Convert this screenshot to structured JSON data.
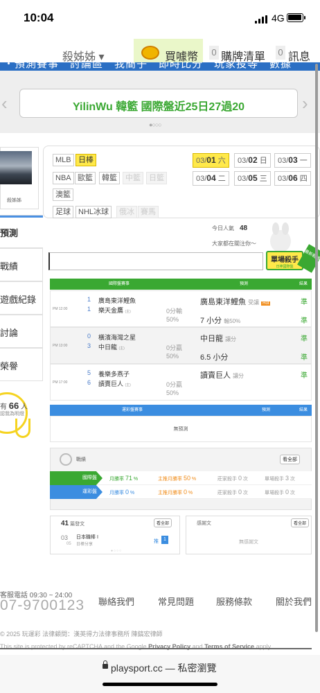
{
  "status_bar": {
    "time": "10:04",
    "network": "4G"
  },
  "nav": {
    "user_label": "殺姊姊 ▾",
    "coin_label": "買噱幣",
    "cart_count": "0",
    "cart_label": "購牌清單",
    "msg_count": "0",
    "msg_label": "訊息",
    "strip_text": "・預測賽事　討論區　我簡子　即時比分　玩家投等　數據"
  },
  "announcement": {
    "text": "YilinWu 韓籃 國際盤近25日27過20",
    "prev": "‹",
    "next": "›",
    "dots": "●○○○"
  },
  "sidebar": {
    "profile_name": "殺姊姊",
    "tabs": [
      "預測",
      "戰績",
      "遊戲紀錄",
      "討論",
      "榮譽"
    ],
    "vote_prefix": "有",
    "vote_count": "66",
    "vote_suffix": "人",
    "vote_sub": "認我為明燈"
  },
  "sports": [
    {
      "label": "MLB",
      "state": "normal"
    },
    {
      "label": "日棒",
      "state": "active"
    },
    {
      "label": "NBA",
      "state": "normal"
    },
    {
      "label": "歐籃",
      "state": "normal"
    },
    {
      "label": "韓籃",
      "state": "normal"
    },
    {
      "label": "中籃",
      "state": "disabled"
    },
    {
      "label": "日籃",
      "state": "disabled"
    },
    {
      "label": "澳籃",
      "state": "normal"
    },
    {
      "label": "足球",
      "state": "normal"
    },
    {
      "label": "NHL冰球",
      "state": "normal"
    },
    {
      "label": "俄冰",
      "state": "disabled"
    },
    {
      "label": "賽馬",
      "state": "disabled"
    }
  ],
  "dates": [
    {
      "md": "03/",
      "day": "01",
      "wd": "六",
      "active": true
    },
    {
      "md": "03/",
      "day": "02",
      "wd": "日",
      "active": false
    },
    {
      "md": "03/",
      "day": "03",
      "wd": "一",
      "active": false
    },
    {
      "md": "03/",
      "day": "04",
      "wd": "二",
      "active": false
    },
    {
      "md": "03/",
      "day": "05",
      "wd": "三",
      "active": false
    },
    {
      "md": "03/",
      "day": "06",
      "wd": "四",
      "active": false
    }
  ],
  "stats": {
    "visitors_label": "今日人氣",
    "visitors_count": "48",
    "watching": "大家都在關注你～",
    "killer_title": "單場殺手",
    "killer_sub": "日棒國際盤",
    "ribbon": "最新戰績"
  },
  "match_table": {
    "headers": [
      "國際盤賽事",
      "預測",
      "結果"
    ],
    "games": [
      {
        "time": "PM 12:00",
        "away_num": "1",
        "away_team": "廣島東洋鯉魚",
        "home_num": "1",
        "home_team": "樂天金鷹",
        "home_tag": "(主)",
        "line1": "0分輸",
        "line2": "50%",
        "pred1_team": "廣島東洋鯉魚",
        "pred1_note": "受讓",
        "pred1_hot": "Hot",
        "pred2_team": "7 小分",
        "pred2_note": "輸50%",
        "result1": "準",
        "result2": "準"
      },
      {
        "time": "PM 13:00",
        "away_num": "0",
        "away_team": "橫濱海灣之星",
        "home_num": "3",
        "home_team": "中日龍",
        "home_tag": "(主)",
        "line1": "0分贏",
        "line2": "50%",
        "pred1_team": "中日龍",
        "pred1_note": "讓分",
        "pred1_hot": "",
        "pred2_team": "6.5 小分",
        "pred2_note": "",
        "result1": "準",
        "result2": "準"
      },
      {
        "time": "PM 17:00",
        "away_num": "5",
        "away_team": "養樂多燕子",
        "home_num": "6",
        "home_team": "讀賣巨人",
        "home_tag": "(主)",
        "line1": "0分贏",
        "line2": "50%",
        "pred1_team": "讀賣巨人",
        "pred1_note": "讓分",
        "pred1_hot": "",
        "pred2_team": "",
        "pred2_note": "",
        "result1": "準",
        "result2": ""
      }
    ]
  },
  "lottery_table": {
    "headers": [
      "運彩盤賽事",
      "預測",
      "結果"
    ],
    "empty": "無預測"
  },
  "record": {
    "title": "戰績",
    "all_button": "看全部",
    "rows": [
      {
        "label": "國際盤",
        "color": "#3aa832",
        "rate_label": "月勝率",
        "rate": "71",
        "main_label": "主推月勝率",
        "main_rate": "50",
        "streak_label": "莊家殺手",
        "streak": "0",
        "single_label": "單場殺手",
        "single": "3",
        "unit": "次"
      },
      {
        "label": "運彩盤",
        "color": "#3b8de0",
        "rate_label": "月勝率",
        "rate": "0",
        "main_label": "主推月勝率",
        "main_rate": "0",
        "streak_label": "莊家殺手",
        "streak": "0",
        "single_label": "單場殺手",
        "single": "0",
        "unit": "次"
      }
    ]
  },
  "posts": {
    "count": "41",
    "label": "篇發文",
    "all_button": "看全部",
    "item": {
      "month": "03",
      "day": "05",
      "title": "日本職棒 I",
      "sub": "日棒分享",
      "push_label": "推",
      "push_count": "1"
    },
    "dots": "●○○○"
  },
  "thanks": {
    "title": "感謝文",
    "all_button": "看全部",
    "empty": "無感謝文"
  },
  "footer": {
    "hotline": "客服電話 09:30 ~ 24:00",
    "phone": "07-9700123",
    "links": [
      "聯絡我們",
      "常見問題",
      "服務條款",
      "關於我們"
    ],
    "copyright": "© 2025 玩運彩 法律顧問：漢英得力法律事務所 陳鎬宏律師",
    "recaptcha_pre": "This site is protected by reCAPTCHA and the Google ",
    "privacy": "Privacy Policy",
    "and": " and ",
    "terms": "Terms of Service",
    "recaptcha_post": " apply."
  },
  "browser": {
    "url": "playsport.cc — 私密瀏覽"
  }
}
